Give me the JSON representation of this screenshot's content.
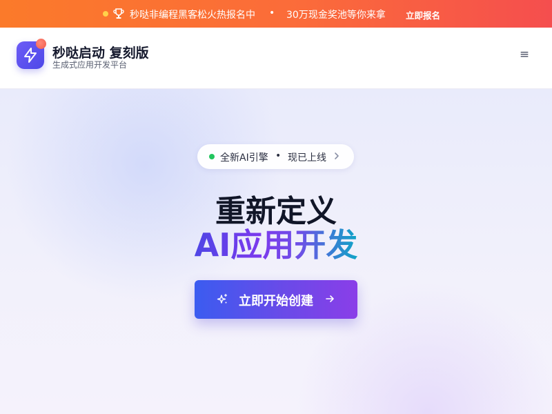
{
  "banner": {
    "text": "秒哒非编程黑客松火热报名中",
    "separator": "•",
    "prize": "30万现金奖池等你来拿",
    "cta": "立即报名"
  },
  "header": {
    "title": "秒哒启动 复刻版",
    "subtitle": "生成式应用开发平台",
    "menu_icon": "≡"
  },
  "hero": {
    "pill": {
      "text1": "全新AI引擎",
      "separator": "•",
      "text2": "现已上线"
    },
    "headline_1": "重新定义",
    "headline_2": "AI应用开发",
    "button_label": "立即开始创建"
  },
  "colors": {
    "banner_start": "#fb7a2a",
    "banner_end": "#f54e4e",
    "brand": "#5b4ff0",
    "status_green": "#22c55e",
    "gradient_accent": "#7c3aed",
    "gradient_teal": "#0ea5c6"
  },
  "icons": {
    "banner_dot": "status-dot-icon",
    "trophy": "trophy-icon",
    "logo": "lightning-icon",
    "menu": "hamburger-menu-icon",
    "pill_chevron": "chevron-right-icon",
    "button_spark": "sparkle-icon",
    "button_arrow": "arrow-right-icon"
  }
}
